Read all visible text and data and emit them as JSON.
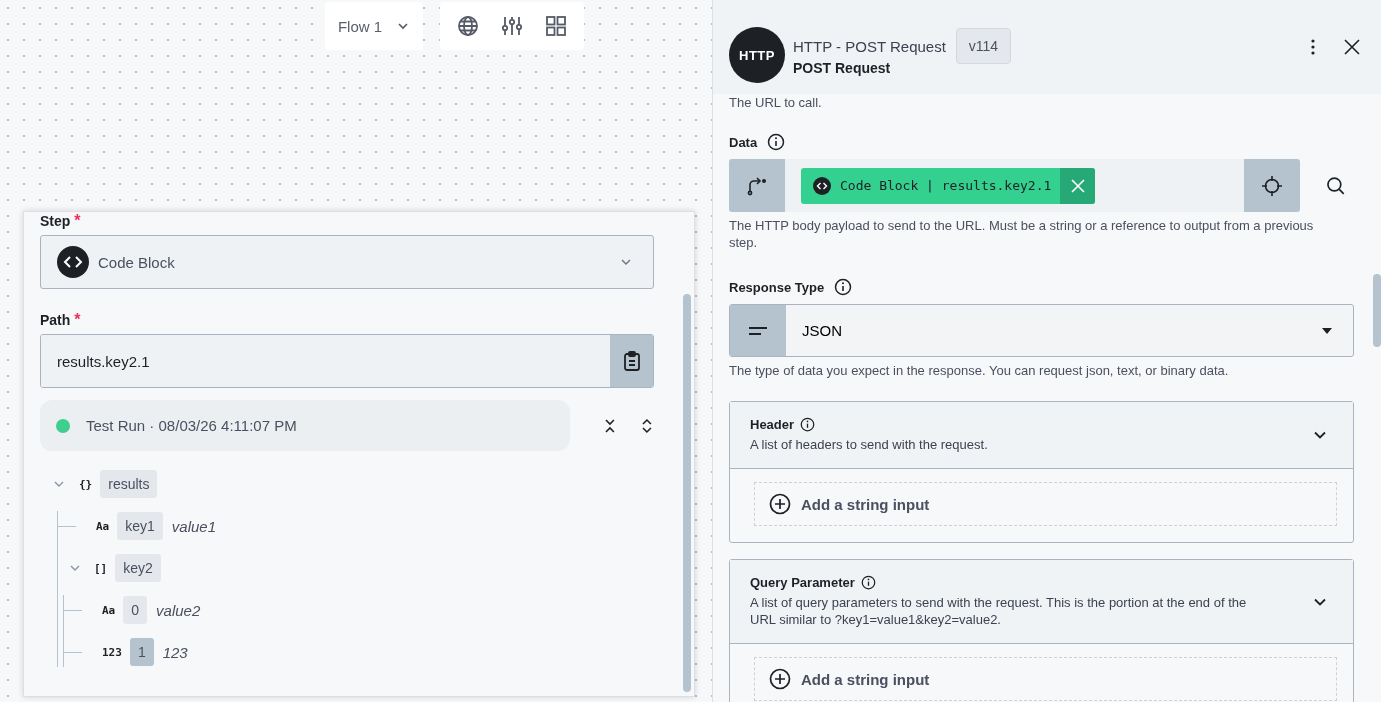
{
  "toolbar": {
    "flow_selector": "Flow 1"
  },
  "step_popover": {
    "step": {
      "label": "Step",
      "required_mark": "*",
      "value": "Code Block"
    },
    "path": {
      "label": "Path",
      "required_mark": "*",
      "value": "results.key2.1"
    },
    "test_run": {
      "color": "#3ecf8e",
      "label": "Test Run · 08/03/26 4:11:07 PM"
    },
    "tree": [
      {
        "key": "results",
        "icon": "{}",
        "expanded": true,
        "selected": false,
        "children": [
          {
            "key": "key1",
            "icon": "Aa",
            "value": "value1",
            "selected": false
          },
          {
            "key": "key2",
            "icon": "[]",
            "expanded": true,
            "selected": false,
            "children": [
              {
                "key": "0",
                "icon": "Aa",
                "value": "value2",
                "selected": false
              },
              {
                "key": "1",
                "icon": "123",
                "value": "123",
                "selected": true
              }
            ]
          }
        ]
      }
    ]
  },
  "panel": {
    "logo": "HTTP",
    "title": "HTTP - POST Request",
    "version": "v114",
    "subtitle": "POST Request",
    "url_help": "The URL to call.",
    "data": {
      "label": "Data",
      "reference": "Code Block | results.key2.1",
      "help": "The HTTP body payload to send to the URL. Must be a string or a reference to output from a previous step."
    },
    "response_type": {
      "label": "Response Type",
      "value": "JSON",
      "help": "The type of data you expect in the response. You can request json, text, or binary data."
    },
    "sections": [
      {
        "title": "Header",
        "description": "A list of headers to send with the request.",
        "expanded": true,
        "add_button": "Add a string input"
      },
      {
        "title": "Query Parameter",
        "description": "A list of query parameters to send with the request. This is the portion at the end of the URL similar to ?key1=value1&key2=value2.",
        "expanded": true,
        "add_button": "Add a string input"
      }
    ]
  }
}
